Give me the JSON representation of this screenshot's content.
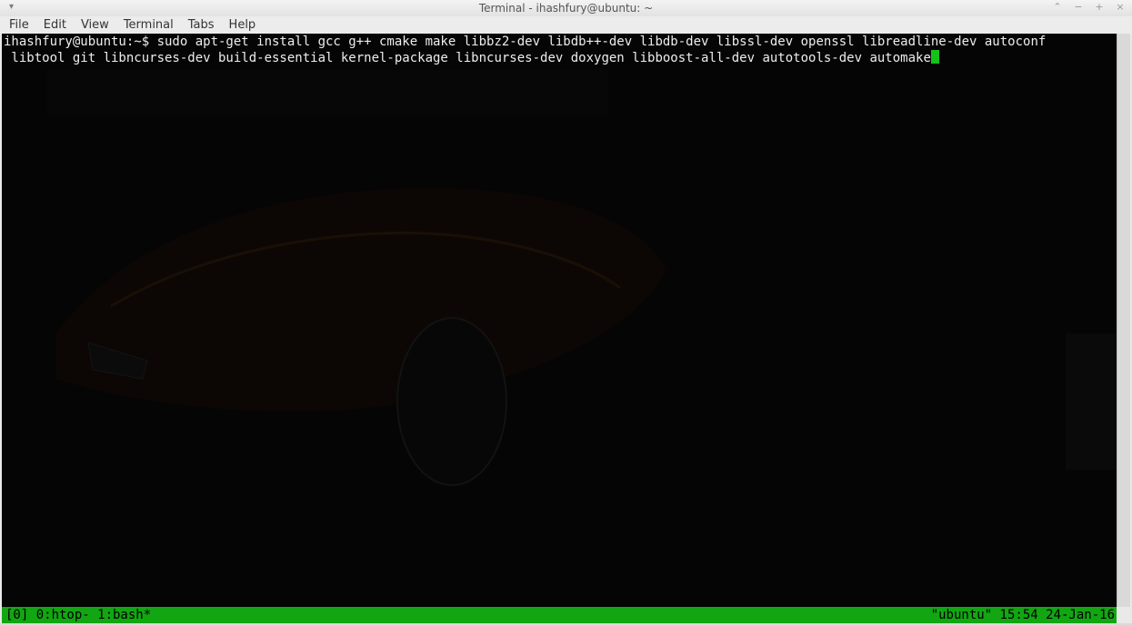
{
  "window": {
    "title": "Terminal - ihashfury@ubuntu: ~",
    "controls": {
      "menu_arrow": "▾",
      "up": "⌃",
      "minimize": "−",
      "maximize": "+",
      "close": "×"
    }
  },
  "menubar": {
    "items": [
      "File",
      "Edit",
      "View",
      "Terminal",
      "Tabs",
      "Help"
    ]
  },
  "terminal": {
    "lines": [
      "ihashfury@ubuntu:~$ sudo apt-get install gcc g++ cmake make libbz2-dev libdb++-dev libdb-dev libssl-dev openssl libreadline-dev autoconf",
      " libtool git libncurses-dev build-essential kernel-package libncurses-dev doxygen libboost-all-dev autotools-dev automake"
    ],
    "cursor_color": "#15c21a"
  },
  "statusbar": {
    "left": "[0] 0:htop- 1:bash*",
    "right": "\"ubuntu\" 15:54 24-Jan-16",
    "color": "#12a612"
  }
}
